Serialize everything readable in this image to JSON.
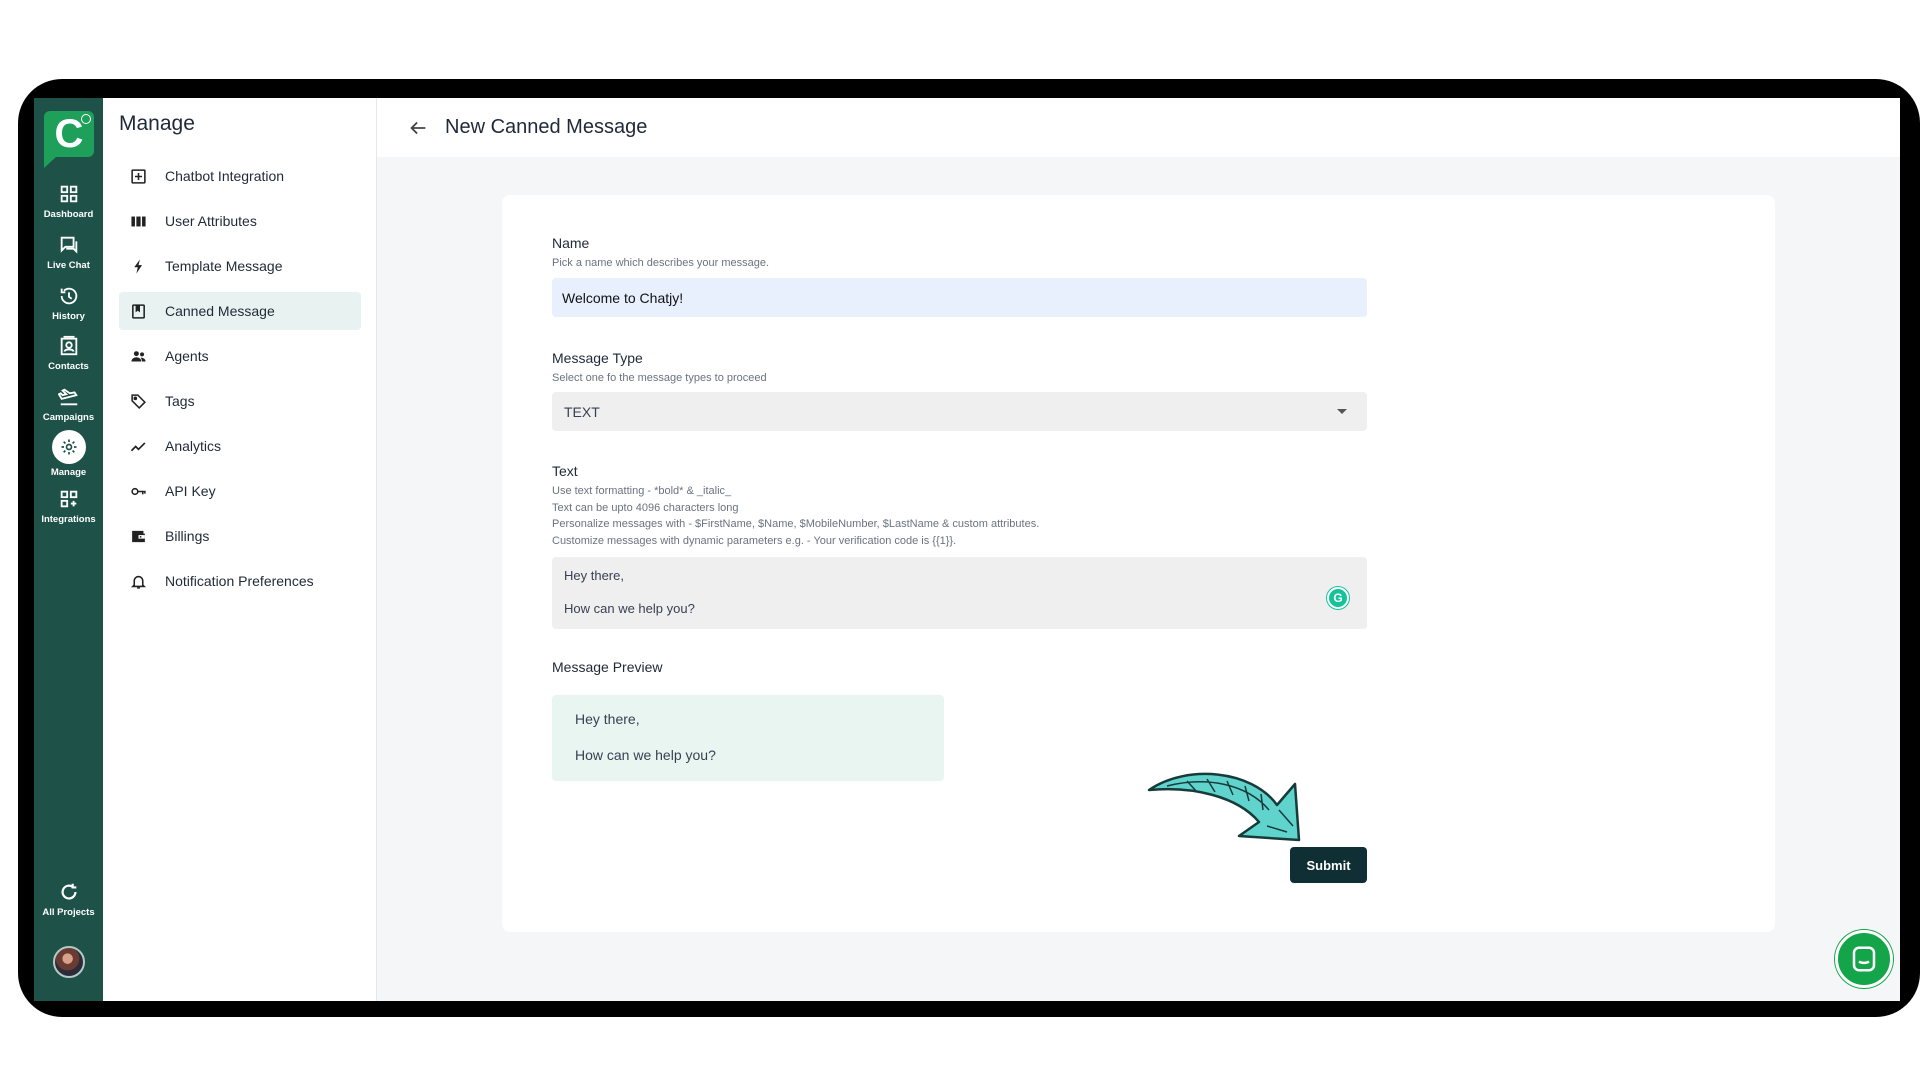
{
  "rail": {
    "items": [
      {
        "label": "Dashboard",
        "icon": "dashboard-icon"
      },
      {
        "label": "Live Chat",
        "icon": "chat-icon"
      },
      {
        "label": "History",
        "icon": "history-icon"
      },
      {
        "label": "Contacts",
        "icon": "contacts-icon"
      },
      {
        "label": "Campaigns",
        "icon": "campaigns-icon"
      },
      {
        "label": "Manage",
        "icon": "settings-icon",
        "active": true
      },
      {
        "label": "Integrations",
        "icon": "integrations-icon"
      }
    ],
    "all_projects": "All Projects"
  },
  "manage": {
    "title": "Manage",
    "items": [
      {
        "label": "Chatbot Integration",
        "icon": "plus-box-icon"
      },
      {
        "label": "User Attributes",
        "icon": "columns-icon"
      },
      {
        "label": "Template Message",
        "icon": "bolt-icon"
      },
      {
        "label": "Canned Message",
        "icon": "bookmark-box-icon",
        "active": true
      },
      {
        "label": "Agents",
        "icon": "people-icon"
      },
      {
        "label": "Tags",
        "icon": "tag-icon"
      },
      {
        "label": "Analytics",
        "icon": "trend-icon"
      },
      {
        "label": "API Key",
        "icon": "key-icon"
      },
      {
        "label": "Billings",
        "icon": "wallet-icon"
      },
      {
        "label": "Notification Preferences",
        "icon": "bell-icon"
      }
    ]
  },
  "header": {
    "title": "New Canned Message"
  },
  "form": {
    "name_label": "Name",
    "name_hint": "Pick a name which describes your message.",
    "name_value": "Welcome to Chatjy!",
    "type_label": "Message Type",
    "type_hint": "Select one fo the message types to proceed",
    "type_value": "TEXT",
    "text_label": "Text",
    "text_hints": [
      "Use text formatting - *bold* & _italic_",
      "Text can be upto 4096 characters long",
      "Personalize messages with - $FirstName, $Name, $MobileNumber, $LastName & custom attributes.",
      "Customize messages with dynamic parameters e.g. - Your verification code is {{1}}."
    ],
    "text_line1": "Hey there,",
    "text_line2": "How can we help you?",
    "preview_label": "Message Preview",
    "preview_line1": "Hey there,",
    "preview_line2": "How can we help you?",
    "submit_label": "Submit"
  },
  "colors": {
    "rail": "#1e5249",
    "accent": "#1fa05a",
    "submit": "#0f2f35",
    "arrow": "#5fd3cc"
  }
}
